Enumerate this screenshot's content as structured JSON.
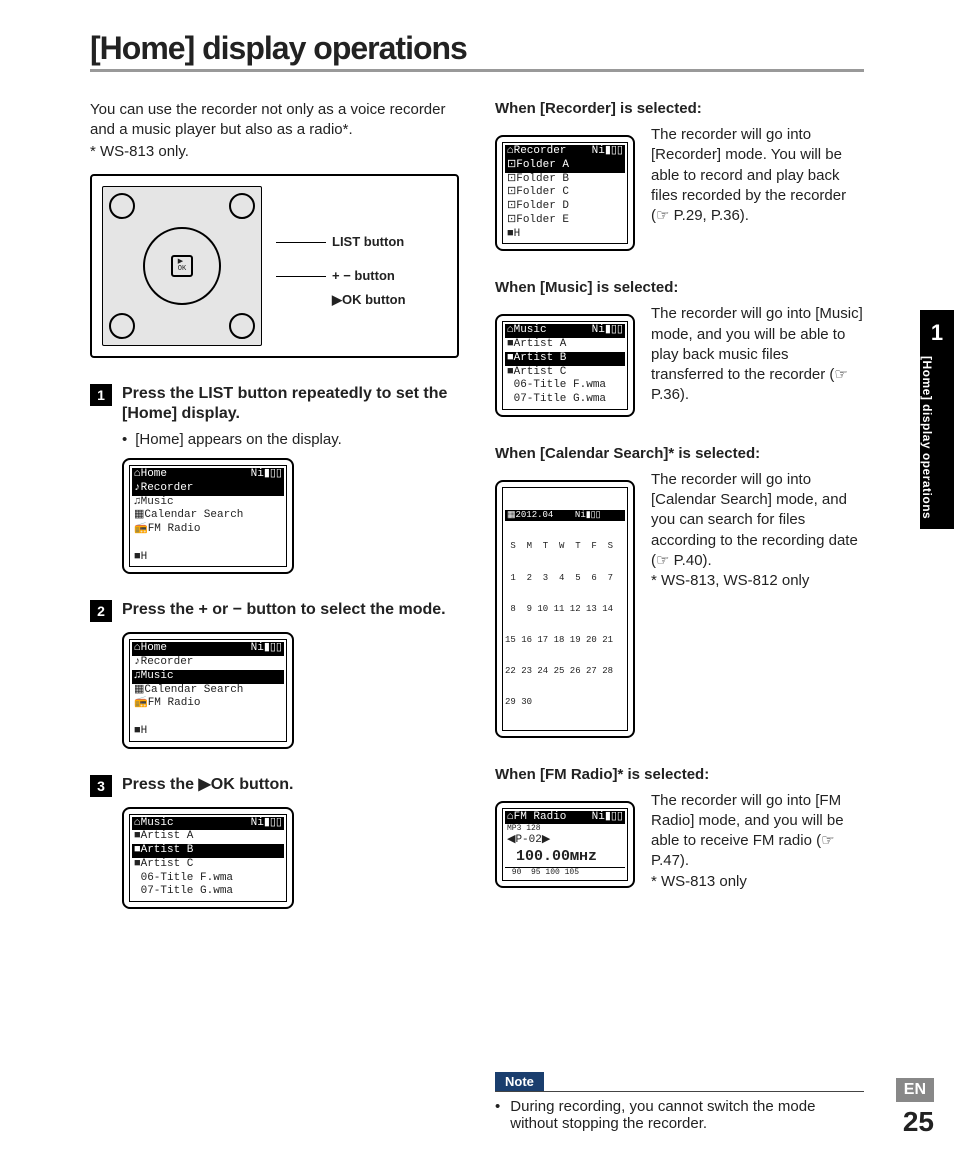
{
  "title": "[Home] display operations",
  "intro": "You can use the recorder not only as a voice recorder and a music player but also as a radio*.",
  "intro_note": "* WS-813 only.",
  "device_labels": {
    "list": "LIST button",
    "plusminus": "+ − button",
    "ok": "▶OK button"
  },
  "steps": [
    {
      "num": "1",
      "title_pre": "Press the ",
      "title_b1": "LIST",
      "title_mid": " button repeatedly to set the [",
      "title_b2": "Home",
      "title_post": "] display.",
      "bullet": "[Home] appears on the display.",
      "lcd": {
        "header_left": "⌂Home",
        "header_right": "Ni▮▯▯",
        "rows": [
          "♪Recorder",
          "♫Music",
          "▦Calendar Search",
          "📻FM Radio"
        ],
        "selected": 0,
        "foot": "■H"
      }
    },
    {
      "num": "2",
      "title": "Press the + or − button to select the mode.",
      "lcd": {
        "header_left": "⌂Home",
        "header_right": "Ni▮▯▯",
        "rows": [
          "♪Recorder",
          "♫Music",
          "▦Calendar Search",
          "📻FM Radio"
        ],
        "selected": 1,
        "foot": "■H"
      }
    },
    {
      "num": "3",
      "title": "Press the ▶OK button.",
      "lcd": {
        "header_left": "⌂Music",
        "header_right": "Ni▮▯▯",
        "rows": [
          "■Artist A",
          "■Artist B",
          "■Artist C",
          " 06-Title F.wma",
          " 07-Title G.wma"
        ],
        "selected": 1,
        "foot": ""
      }
    }
  ],
  "modes": [
    {
      "head_pre": "When [",
      "head_b": "Recorder",
      "head_post": "] is selected:",
      "lcd": {
        "header_left": "⌂Recorder",
        "header_right": "Ni▮▯▯",
        "rows": [
          "⊡Folder A",
          "⊡Folder B",
          "⊡Folder C",
          "⊡Folder D",
          "⊡Folder E"
        ],
        "selected": 0,
        "foot": "■H"
      },
      "text": "The recorder will go into [Recorder] mode. You will be able to record and play back files recorded by the recorder (☞ P.29, P.36).",
      "note": ""
    },
    {
      "head_pre": "When [",
      "head_b": "Music",
      "head_post": "] is selected:",
      "lcd": {
        "header_left": "⌂Music",
        "header_right": "Ni▮▯▯",
        "rows": [
          "■Artist A",
          "■Artist B",
          "■Artist C",
          " 06-Title F.wma",
          " 07-Title G.wma"
        ],
        "selected": 1,
        "foot": ""
      },
      "text": "The recorder will go into [Music] mode, and you will be able to play back music files transferred to the recorder (☞ P.36).",
      "note": ""
    },
    {
      "head_pre": "When [",
      "head_b": "Calendar Search",
      "head_post": "]* is selected:",
      "lcd_cal": {
        "header": "▦2012.04    Ni▮▯▯",
        "days": " S  M  T  W  T  F  S",
        "w1": " 1  2  3  4  5  6  7",
        "w2": " 8  9 10 11 12 13 14",
        "w3": "15 16 17 18 19 20 21",
        "w4": "22 23 24 25 26 27 28",
        "w5": "29 30"
      },
      "text": "The recorder will go into [Calendar Search] mode, and you can search for files according to the recording date (☞ P.40).",
      "note": "* WS-813, WS-812 only"
    },
    {
      "head_pre": "When [",
      "head_b": "FM Radio",
      "head_post": "]* is selected:",
      "lcd_fm": {
        "header_left": "⌂FM Radio",
        "header_right": "Ni▮▯▯",
        "line1": "MP3 128",
        "line2": "◀P-02▶",
        "freq": " 100.00ᴍʜᴢ",
        "scale": " 90  95 100 105"
      },
      "text": "The recorder will go into [FM Radio] mode, and you will be able to receive FM radio (☞ P.47).",
      "note": "* WS-813 only"
    }
  ],
  "note_label": "Note",
  "note_text": "During recording, you cannot switch the mode without stopping the recorder.",
  "sidebar": {
    "chapter": "1",
    "text": "[Home] display operations"
  },
  "lang": "EN",
  "page": "25"
}
